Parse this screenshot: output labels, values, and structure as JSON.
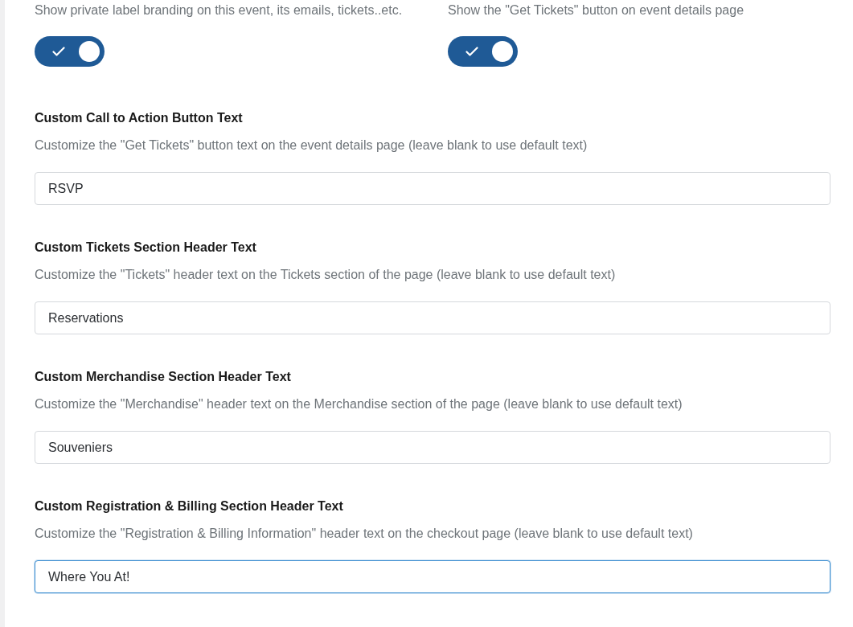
{
  "toggles": [
    {
      "description": "Show private label branding on this event, its emails, tickets..etc.",
      "on": true
    },
    {
      "description": "Show the \"Get Tickets\" button on event details page",
      "on": true
    }
  ],
  "fields": [
    {
      "title": "Custom Call to Action Button Text",
      "description": "Customize the \"Get Tickets\" button text on the event details page (leave blank to use default text)",
      "value": "RSVP",
      "focused": false
    },
    {
      "title": "Custom Tickets Section Header Text",
      "description": "Customize the \"Tickets\" header text on the Tickets section of the page (leave blank to use default text)",
      "value": "Reservations",
      "focused": false
    },
    {
      "title": "Custom Merchandise Section Header Text",
      "description": "Customize the \"Merchandise\" header text on the Merchandise section of the page (leave blank to use default text)",
      "value": "Souveniers",
      "focused": false
    },
    {
      "title": "Custom Registration & Billing Section Header Text",
      "description": "Customize the \"Registration & Billing Information\" header text on the checkout page (leave blank to use default text)",
      "value": "Where You At!",
      "focused": true
    }
  ]
}
